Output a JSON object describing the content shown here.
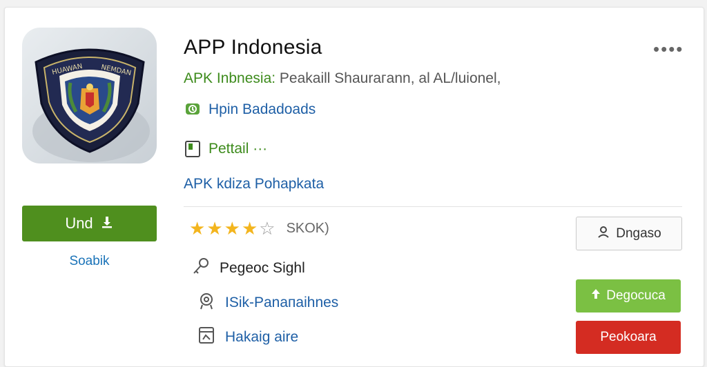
{
  "app": {
    "title": "APP Indonesia",
    "developer": "APK Inbnesia:",
    "subtitle_rest": " Peakaill Shaurагann, al AL/luionel,",
    "icon_name": "police-badge-icon",
    "icon_text_top": "HUAWAN",
    "icon_text_top_right": "NEMDAN"
  },
  "more_label": "••••",
  "downloads_label": "Hpin Badadoads",
  "details_label": "Pettail ···",
  "link_label": "APK kdiza Pohapkata",
  "install": {
    "label": "Und",
    "icon": "install-icon"
  },
  "sub_link": "Soabik",
  "rating": {
    "stars": 4,
    "max": 5,
    "count_label": "SKOK)"
  },
  "permission_label": "Pegeoc Sighl",
  "policy_label": "ISik-Panaпаihnes",
  "notes_label": "Hakaig aire",
  "actions": {
    "outline_label": "Dngaso",
    "green_label": "Degoсuca",
    "red_label": "Peokoara"
  },
  "colors": {
    "install_green": "#4f8f1e",
    "action_green": "#7bc043",
    "action_red": "#d42c22",
    "link_blue": "#1e5fa6",
    "dev_green": "#3d8b1c",
    "star": "#f3b51e"
  }
}
